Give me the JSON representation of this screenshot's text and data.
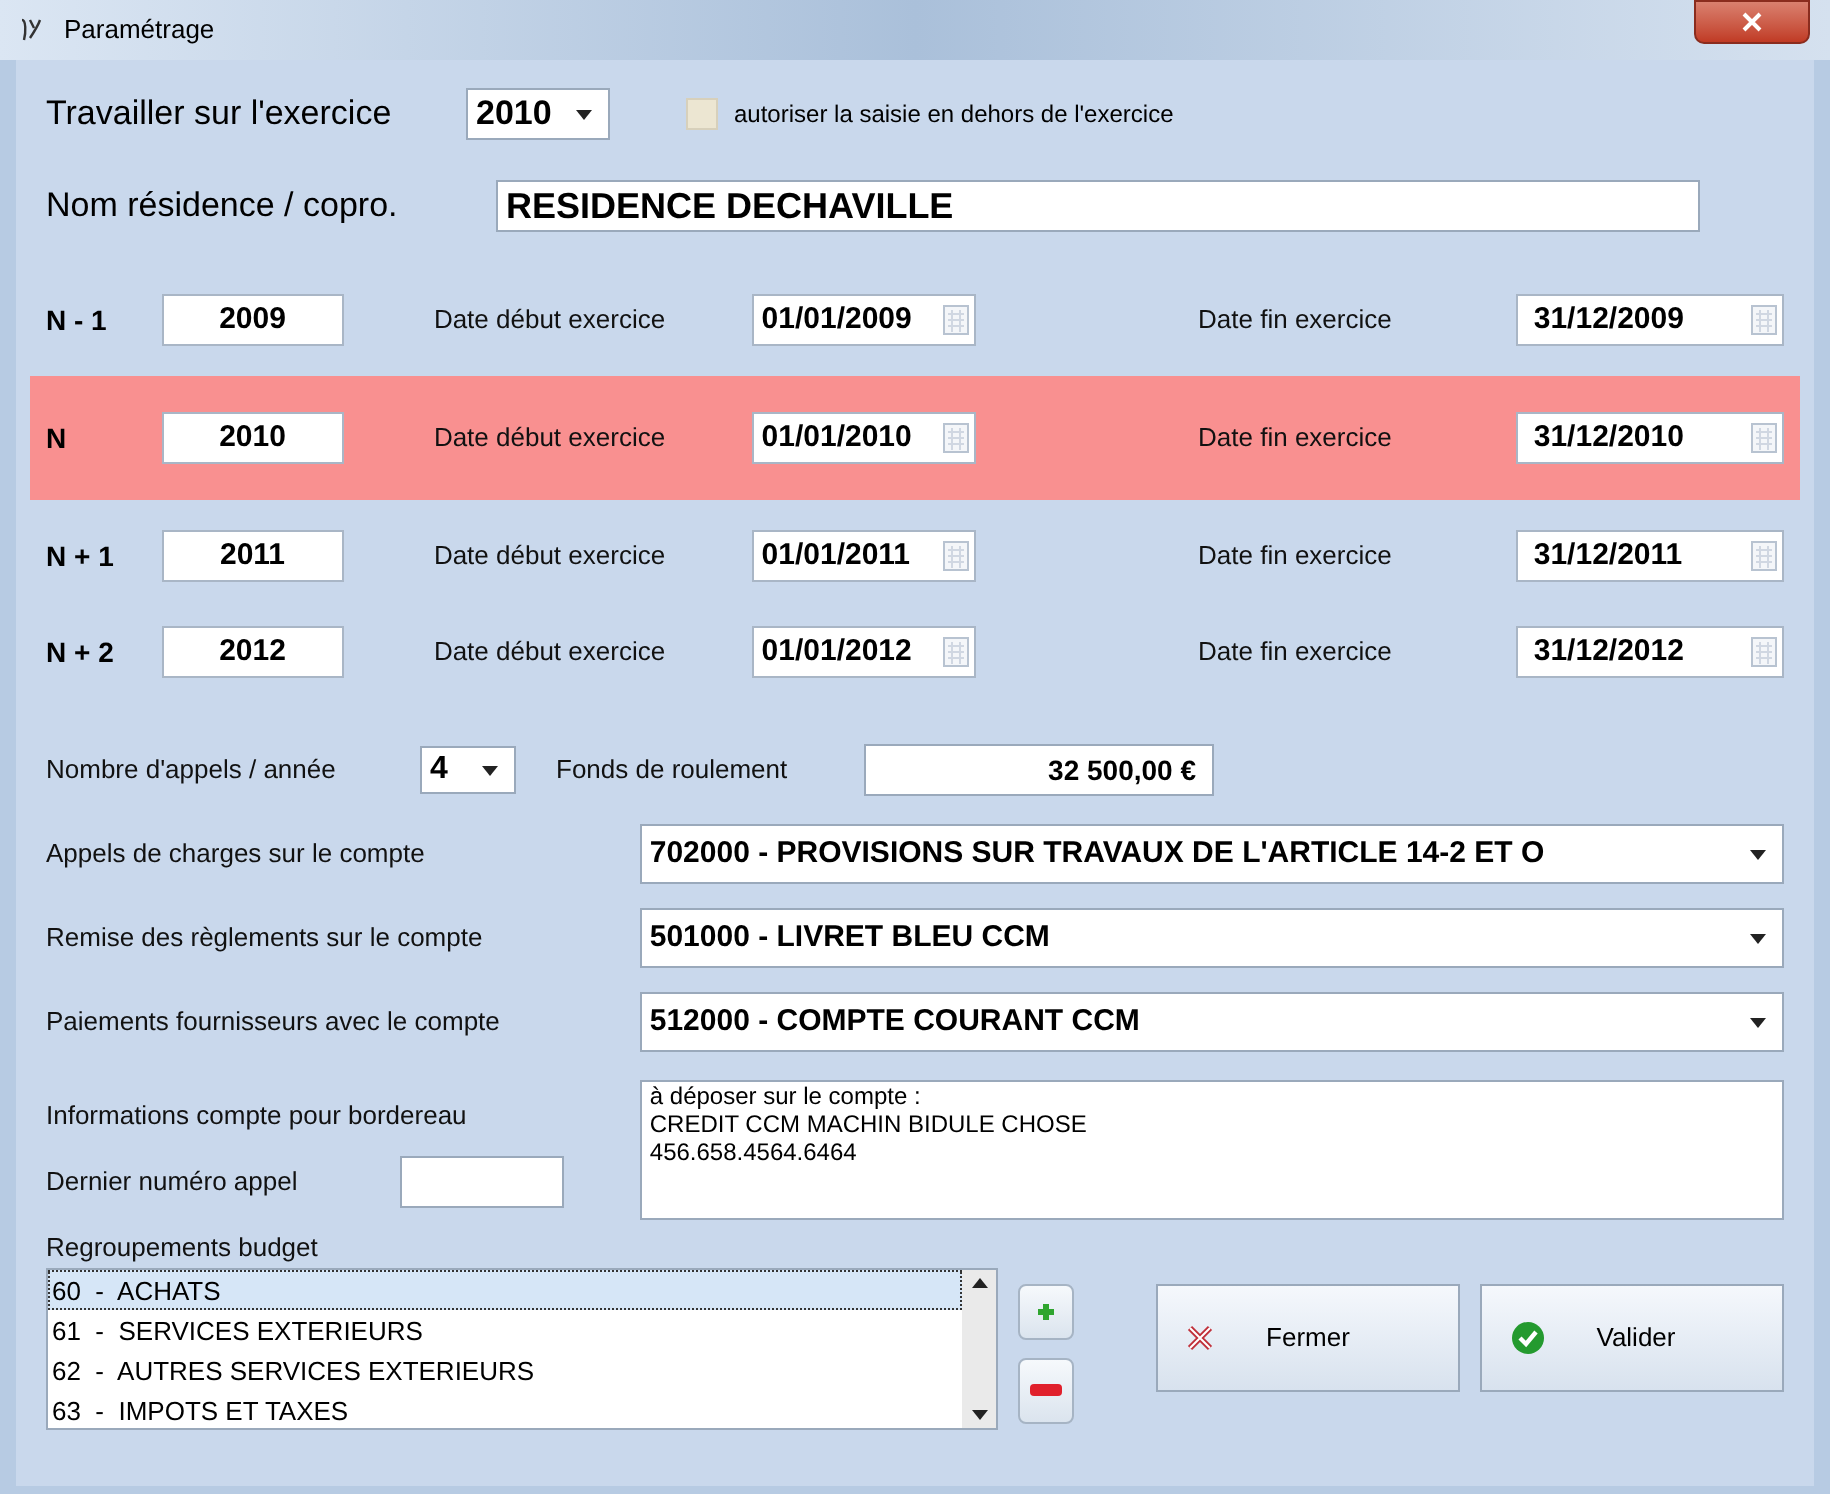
{
  "window": {
    "title": "Paramétrage"
  },
  "exercise": {
    "label": "Travailler sur l'exercice",
    "value": "2010"
  },
  "allow_outside": {
    "label": "autoriser la saisie en dehors de l'exercice",
    "checked": false
  },
  "residence": {
    "label": "Nom résidence / copro.",
    "value": "RESIDENCE DECHAVILLE"
  },
  "years": [
    {
      "label": "N - 1",
      "year": "2009",
      "start_label": "Date début exercice",
      "start": "01/01/2009",
      "end_label": "Date fin exercice",
      "end": "31/12/2009",
      "selected": false
    },
    {
      "label": "N",
      "year": "2010",
      "start_label": "Date début exercice",
      "start": "01/01/2010",
      "end_label": "Date fin exercice",
      "end": "31/12/2010",
      "selected": true
    },
    {
      "label": "N + 1",
      "year": "2011",
      "start_label": "Date début exercice",
      "start": "01/01/2011",
      "end_label": "Date fin exercice",
      "end": "31/12/2011",
      "selected": false
    },
    {
      "label": "N + 2",
      "year": "2012",
      "start_label": "Date début exercice",
      "start": "01/01/2012",
      "end_label": "Date fin exercice",
      "end": "31/12/2012",
      "selected": false
    }
  ],
  "calls_per_year": {
    "label": "Nombre d'appels / année",
    "value": "4"
  },
  "working_fund": {
    "label": "Fonds de roulement",
    "value": "32 500,00 €"
  },
  "accounts": [
    {
      "label": "Appels de charges sur le compte",
      "value": "702000 - PROVISIONS SUR TRAVAUX DE L'ARTICLE 14-2 ET O"
    },
    {
      "label": "Remise des règlements sur le compte",
      "value": "501000 - LIVRET BLEU CCM"
    },
    {
      "label": "Paiements fournisseurs avec le compte",
      "value": "512000 - COMPTE COURANT CCM"
    }
  ],
  "slip_info": {
    "label": "Informations compte pour bordereau",
    "lines": [
      "à déposer sur le compte :",
      "CREDIT CCM MACHIN BIDULE CHOSE",
      "456.658.4564.6464"
    ]
  },
  "last_call_number": {
    "label": "Dernier numéro appel"
  },
  "budget_groups": {
    "label": "Regroupements budget",
    "items": [
      {
        "text": "60  -  ACHATS",
        "selected": true
      },
      {
        "text": "61  -  SERVICES EXTERIEURS",
        "selected": false
      },
      {
        "text": "62  -  AUTRES SERVICES EXTERIEURS",
        "selected": false
      },
      {
        "text": "63  -  IMPOTS ET TAXES",
        "selected": false
      }
    ]
  },
  "buttons": [
    {
      "kind": "close",
      "label": "Fermer"
    },
    {
      "kind": "validate",
      "label": "Valider"
    }
  ]
}
